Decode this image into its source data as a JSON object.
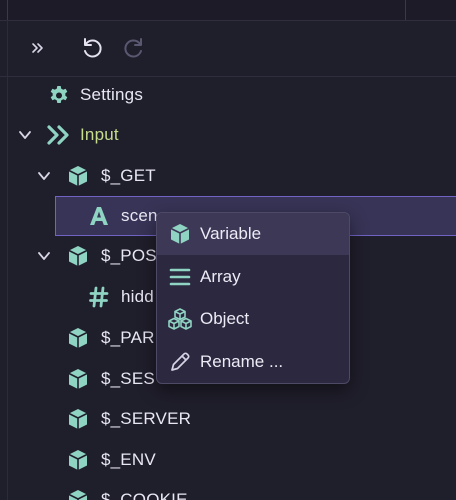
{
  "colors": {
    "background": "#1f1e2b",
    "selection": "#383457",
    "selection_border": "#6f63c4",
    "icon_teal": "#8fd3c3",
    "input_label": "#c7dd8e",
    "menu_background": "#2b283f"
  },
  "toolbar": {
    "expand_icon": "double-chevron-right-icon",
    "undo_icon": "undo-icon",
    "redo_icon": "redo-icon"
  },
  "tree": {
    "settings": {
      "label": "Settings",
      "icon": "gear-icon"
    },
    "input": {
      "label": "Input",
      "icon": "double-chevron-icon",
      "expanded": true
    },
    "get": {
      "label": "$_GET",
      "icon": "cube-icon",
      "expanded": true
    },
    "get_child": {
      "label": "scene_id",
      "visible_label": "scen",
      "icon": "letter-a-icon"
    },
    "post": {
      "label": "$_POST",
      "visible_label": "$_POS",
      "icon": "cube-icon",
      "expanded": true
    },
    "post_child": {
      "label": "hidd",
      "icon": "hash-icon"
    },
    "params": {
      "label": "$_PAR",
      "icon": "cube-icon"
    },
    "session": {
      "label": "$_SES",
      "icon": "cube-icon"
    },
    "server": {
      "label": "$_SERVER",
      "icon": "cube-icon"
    },
    "env": {
      "label": "$_ENV",
      "icon": "cube-icon"
    },
    "cookie": {
      "label": "$_COOKIE",
      "icon": "cube-icon"
    }
  },
  "context_menu": {
    "items": [
      {
        "label": "Variable",
        "icon": "cube-icon",
        "active": true
      },
      {
        "label": "Array",
        "icon": "list-icon",
        "active": false
      },
      {
        "label": "Object",
        "icon": "cubes-icon",
        "active": false
      },
      {
        "label": "Rename ...",
        "icon": "pencil-icon",
        "active": false
      }
    ]
  }
}
